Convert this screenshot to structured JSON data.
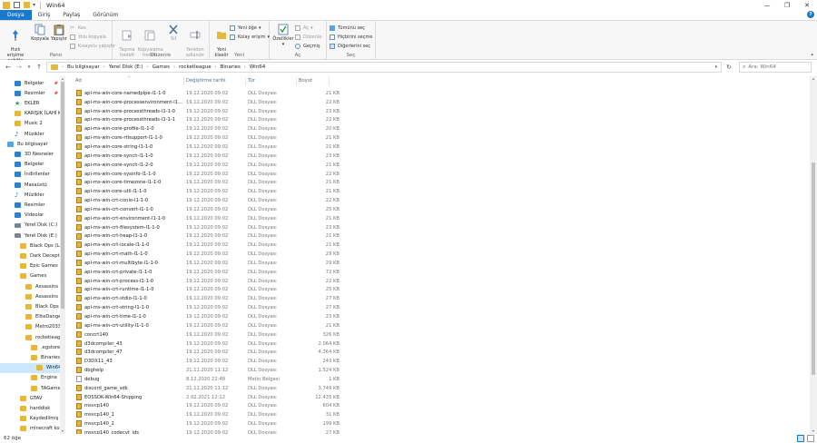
{
  "window": {
    "title": "Win64",
    "minimize": "—",
    "maximize": "❐",
    "close": "✕"
  },
  "tabs": [
    "Dosya",
    "Giriş",
    "Paylaş",
    "Görünüm"
  ],
  "help": "?",
  "ribbon": {
    "pano": {
      "label": "Pano",
      "pin": "Hızlı erişime\nsabitle",
      "copy": "Kopyala",
      "paste": "Yapıştır",
      "cut": "Kes",
      "copy_path": "Yolu kopyala",
      "paste_shortcut": "Kısayolu yapıştır"
    },
    "duzenle": {
      "label": "Düzenle",
      "move_to": "Taşıma\nhedefi",
      "copy_to": "Kopyalama\nhedefi",
      "delete": "Sil",
      "rename": "Yeniden\nadlandır"
    },
    "yeni": {
      "label": "Yeni",
      "new_folder": "Yeni\nklasör",
      "new_item": "Yeni öğe",
      "easy_access": "Kolay erişim"
    },
    "ac": {
      "label": "Aç",
      "properties": "Özellikler",
      "open": "Aç",
      "edit": "Düzenle",
      "history": "Geçmiş"
    },
    "sec": {
      "label": "Seç",
      "select_all": "Tümünü seç",
      "select_none": "Hiçbirini seçme",
      "invert": "Diğerlerini seç"
    }
  },
  "address": {
    "crumbs": [
      "Bu bilgisayar",
      "Yerel Disk (E:)",
      "Games",
      "rocketleague",
      "Binaries",
      "Win64"
    ],
    "search_placeholder": "Ara: Win64"
  },
  "nav": [
    {
      "label": "Belgeler",
      "icon": "documents-icon",
      "indent": 16,
      "pin": true
    },
    {
      "label": "Resimler",
      "icon": "pictures-icon",
      "indent": 16,
      "pin": true
    },
    {
      "label": "EKLER",
      "icon": "star-icon",
      "indent": 16
    },
    {
      "label": "KARIŞIK İLAHİ KL",
      "icon": "folder-icon",
      "indent": 16
    },
    {
      "label": "Music 2",
      "icon": "folder-icon",
      "indent": 16
    },
    {
      "label": "Müzikler",
      "icon": "music-icon",
      "indent": 16
    },
    {
      "label": "Bu bilgisayar",
      "icon": "pc-icon",
      "indent": 8
    },
    {
      "label": "3D Nesneler",
      "icon": "3d-objects-icon",
      "indent": 16
    },
    {
      "label": "Belgeler",
      "icon": "documents-icon",
      "indent": 16
    },
    {
      "label": "İndirilenler",
      "icon": "downloads-icon",
      "indent": 16
    },
    {
      "label": "Masaüstü",
      "icon": "desktop-icon",
      "indent": 16
    },
    {
      "label": "Müzikler",
      "icon": "music-icon",
      "indent": 16
    },
    {
      "label": "Resimler",
      "icon": "pictures-icon",
      "indent": 16
    },
    {
      "label": "Videolar",
      "icon": "videos-icon",
      "indent": 16
    },
    {
      "label": "Yerel Disk (C:)",
      "icon": "drive-icon",
      "indent": 16
    },
    {
      "label": "Yerel Disk (E:)",
      "icon": "drive-icon",
      "indent": 16
    },
    {
      "label": "Black Ops (LAP",
      "icon": "folder-icon",
      "indent": 22
    },
    {
      "label": "Dark Deception",
      "icon": "folder-icon",
      "indent": 22
    },
    {
      "label": "Epic Games",
      "icon": "folder-icon",
      "indent": 22
    },
    {
      "label": "Games",
      "icon": "folder-icon",
      "indent": 22
    },
    {
      "label": "Assassins Cre",
      "icon": "folder-icon",
      "indent": 28
    },
    {
      "label": "Assassins Cre",
      "icon": "folder-icon",
      "indent": 28
    },
    {
      "label": "Black Ops (LA",
      "icon": "folder-icon",
      "indent": 28
    },
    {
      "label": "EliteDangerou",
      "icon": "folder-icon",
      "indent": 28
    },
    {
      "label": "Metro2033Re",
      "icon": "folder-icon",
      "indent": 28
    },
    {
      "label": "rocketleague",
      "icon": "folder-icon",
      "indent": 28
    },
    {
      "label": ".egstore",
      "icon": "folder-icon",
      "indent": 34
    },
    {
      "label": "Binaries",
      "icon": "folder-icon",
      "indent": 34
    },
    {
      "label": "Win64",
      "icon": "folder-icon",
      "indent": 40,
      "selected": true
    },
    {
      "label": "Engine",
      "icon": "folder-icon",
      "indent": 34
    },
    {
      "label": "TAGame",
      "icon": "folder-icon",
      "indent": 34
    },
    {
      "label": "GTAV",
      "icon": "folder-icon",
      "indent": 22
    },
    {
      "label": "harddisk",
      "icon": "folder-icon",
      "indent": 22
    },
    {
      "label": "Kaydedilmiş Re",
      "icon": "folder-icon",
      "indent": 22
    },
    {
      "label": "minecraft ko",
      "icon": "folder-icon",
      "indent": 22
    }
  ],
  "columns": {
    "name": "Ad",
    "date": "Değiştirme tarihi",
    "type": "Tür",
    "size": "Boyut"
  },
  "files": [
    {
      "name": "api-ms-win-core-namedpipe-l1-1-0",
      "date": "19.12.2020 09:02",
      "type": "DLL Dosyası",
      "size": "21 KB",
      "icon": "dll"
    },
    {
      "name": "api-ms-win-core-processenvironment-l1...",
      "date": "19.12.2020 09:02",
      "type": "DLL Dosyası",
      "size": "22 KB",
      "icon": "dll"
    },
    {
      "name": "api-ms-win-core-processthreads-l1-1-0",
      "date": "19.12.2020 09:02",
      "type": "DLL Dosyası",
      "size": "23 KB",
      "icon": "dll"
    },
    {
      "name": "api-ms-win-core-processthreads-l1-1-1",
      "date": "19.12.2020 09:02",
      "type": "DLL Dosyası",
      "size": "22 KB",
      "icon": "dll"
    },
    {
      "name": "api-ms-win-core-profile-l1-1-0",
      "date": "19.12.2020 09:02",
      "type": "DLL Dosyası",
      "size": "20 KB",
      "icon": "dll"
    },
    {
      "name": "api-ms-win-core-rtlsupport-l1-1-0",
      "date": "19.12.2020 09:02",
      "type": "DLL Dosyası",
      "size": "21 KB",
      "icon": "dll"
    },
    {
      "name": "api-ms-win-core-string-l1-1-0",
      "date": "19.12.2020 09:02",
      "type": "DLL Dosyası",
      "size": "21 KB",
      "icon": "dll"
    },
    {
      "name": "api-ms-win-core-synch-l1-1-0",
      "date": "19.12.2020 09:02",
      "type": "DLL Dosyası",
      "size": "23 KB",
      "icon": "dll"
    },
    {
      "name": "api-ms-win-core-synch-l1-2-0",
      "date": "19.12.2020 09:02",
      "type": "DLL Dosyası",
      "size": "21 KB",
      "icon": "dll"
    },
    {
      "name": "api-ms-win-core-sysinfo-l1-1-0",
      "date": "19.12.2020 09:02",
      "type": "DLL Dosyası",
      "size": "22 KB",
      "icon": "dll"
    },
    {
      "name": "api-ms-win-core-timezone-l1-1-0",
      "date": "19.12.2020 09:02",
      "type": "DLL Dosyası",
      "size": "21 KB",
      "icon": "dll"
    },
    {
      "name": "api-ms-win-core-util-l1-1-0",
      "date": "19.12.2020 09:02",
      "type": "DLL Dosyası",
      "size": "21 KB",
      "icon": "dll"
    },
    {
      "name": "api-ms-win-crt-conio-l1-1-0",
      "date": "19.12.2020 09:02",
      "type": "DLL Dosyası",
      "size": "22 KB",
      "icon": "dll"
    },
    {
      "name": "api-ms-win-crt-convert-l1-1-0",
      "date": "19.12.2020 09:02",
      "type": "DLL Dosyası",
      "size": "25 KB",
      "icon": "dll"
    },
    {
      "name": "api-ms-win-crt-environment-l1-1-0",
      "date": "19.12.2020 09:02",
      "type": "DLL Dosyası",
      "size": "21 KB",
      "icon": "dll"
    },
    {
      "name": "api-ms-win-crt-filesystem-l1-1-0",
      "date": "19.12.2020 09:02",
      "type": "DLL Dosyası",
      "size": "23 KB",
      "icon": "dll"
    },
    {
      "name": "api-ms-win-crt-heap-l1-1-0",
      "date": "19.12.2020 09:02",
      "type": "DLL Dosyası",
      "size": "21 KB",
      "icon": "dll"
    },
    {
      "name": "api-ms-win-crt-locale-l1-1-0",
      "date": "19.12.2020 09:02",
      "type": "DLL Dosyası",
      "size": "21 KB",
      "icon": "dll"
    },
    {
      "name": "api-ms-win-crt-math-l1-1-0",
      "date": "19.12.2020 09:02",
      "type": "DLL Dosyası",
      "size": "29 KB",
      "icon": "dll"
    },
    {
      "name": "api-ms-win-crt-multibyte-l1-1-0",
      "date": "19.12.2020 09:02",
      "type": "DLL Dosyası",
      "size": "29 KB",
      "icon": "dll"
    },
    {
      "name": "api-ms-win-crt-private-l1-1-0",
      "date": "19.12.2020 09:02",
      "type": "DLL Dosyası",
      "size": "72 KB",
      "icon": "dll"
    },
    {
      "name": "api-ms-win-crt-process-l1-1-0",
      "date": "19.12.2020 09:02",
      "type": "DLL Dosyası",
      "size": "22 KB",
      "icon": "dll"
    },
    {
      "name": "api-ms-win-crt-runtime-l1-1-0",
      "date": "19.12.2020 09:02",
      "type": "DLL Dosyası",
      "size": "25 KB",
      "icon": "dll"
    },
    {
      "name": "api-ms-win-crt-stdio-l1-1-0",
      "date": "19.12.2020 09:02",
      "type": "DLL Dosyası",
      "size": "27 KB",
      "icon": "dll"
    },
    {
      "name": "api-ms-win-crt-string-l1-1-0",
      "date": "19.12.2020 09:02",
      "type": "DLL Dosyası",
      "size": "27 KB",
      "icon": "dll"
    },
    {
      "name": "api-ms-win-crt-time-l1-1-0",
      "date": "19.12.2020 09:02",
      "type": "DLL Dosyası",
      "size": "23 KB",
      "icon": "dll"
    },
    {
      "name": "api-ms-win-crt-utility-l1-1-0",
      "date": "19.12.2020 09:02",
      "type": "DLL Dosyası",
      "size": "21 KB",
      "icon": "dll"
    },
    {
      "name": "concrt140",
      "date": "19.12.2020 09:02",
      "type": "DLL Dosyası",
      "size": "326 KB",
      "icon": "dll"
    },
    {
      "name": "d3dcompiler_43",
      "date": "19.12.2020 09:02",
      "type": "DLL Dosyası",
      "size": "2.064 KB",
      "icon": "dll"
    },
    {
      "name": "d3dcompiler_47",
      "date": "19.12.2020 09:02",
      "type": "DLL Dosyası",
      "size": "4.364 KB",
      "icon": "dll"
    },
    {
      "name": "D3DX11_43",
      "date": "19.12.2020 09:02",
      "type": "DLL Dosyası",
      "size": "243 KB",
      "icon": "dll"
    },
    {
      "name": "dbghelp",
      "date": "21.11.2020 11:12",
      "type": "DLL Dosyası",
      "size": "1.524 KB",
      "icon": "dll"
    },
    {
      "name": "debug",
      "date": "8.12.2020 22:48",
      "type": "Metin Belgesi",
      "size": "1 KB",
      "icon": "txt"
    },
    {
      "name": "discord_game_sdk",
      "date": "21.11.2020 11:12",
      "type": "DLL Dosyası",
      "size": "3.749 KB",
      "icon": "dll"
    },
    {
      "name": "EOSSDK-Win64-Shipping",
      "date": "2.02.2021 12:12",
      "type": "DLL Dosyası",
      "size": "12.435 KB",
      "icon": "dll"
    },
    {
      "name": "msvcp140",
      "date": "19.12.2020 09:02",
      "type": "DLL Dosyası",
      "size": "604 KB",
      "icon": "dll"
    },
    {
      "name": "msvcp140_1",
      "date": "19.12.2020 09:02",
      "type": "DLL Dosyası",
      "size": "31 KB",
      "icon": "dll"
    },
    {
      "name": "msvcp140_2",
      "date": "19.12.2020 09:02",
      "type": "DLL Dosyası",
      "size": "199 KB",
      "icon": "dll"
    },
    {
      "name": "msvcp140_codecvt_ids",
      "date": "19.12.2020 09:02",
      "type": "DLL Dosyası",
      "size": "27 KB",
      "icon": "dll"
    }
  ],
  "status": {
    "count": "62 öğe"
  },
  "colors": {
    "accent": "#1979ca",
    "folder": "#e7b63c",
    "selected": "#cce8ff"
  }
}
